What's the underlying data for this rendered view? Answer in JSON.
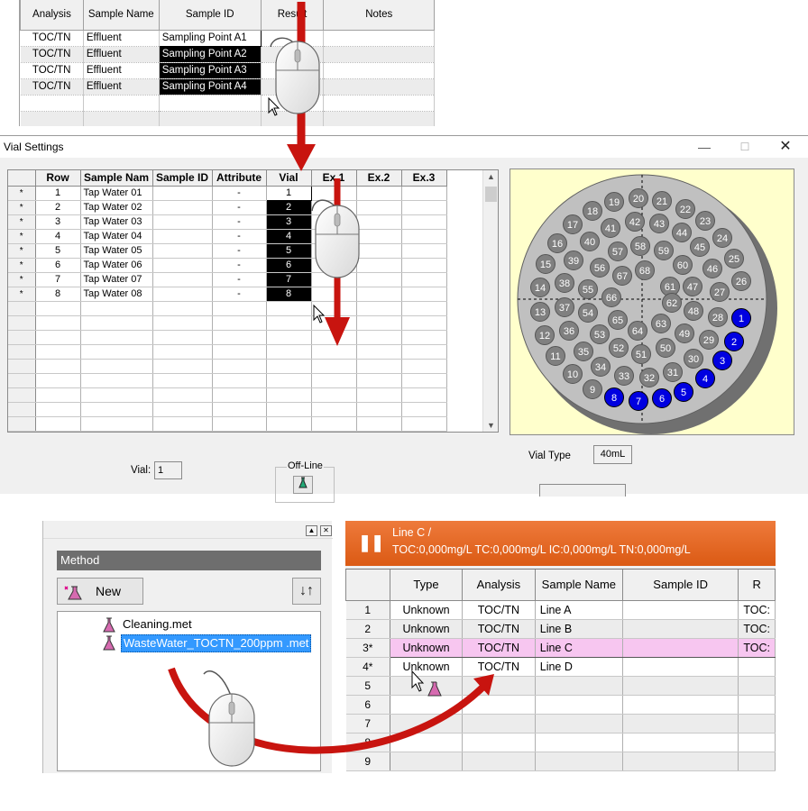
{
  "top_grid": {
    "columns": [
      "Analysis",
      "Sample Name",
      "Sample ID",
      "Result",
      "Notes"
    ],
    "rows": [
      [
        "TOC/TN",
        "Effluent",
        "Sampling Point A1",
        "",
        ""
      ],
      [
        "TOC/TN",
        "Effluent",
        "Sampling Point A2",
        "",
        ""
      ],
      [
        "TOC/TN",
        "Effluent",
        "Sampling Point A3",
        "",
        ""
      ],
      [
        "TOC/TN",
        "Effluent",
        "Sampling Point A4",
        "",
        ""
      ],
      [
        "",
        "",
        "",
        "",
        ""
      ],
      [
        "",
        "",
        "",
        "",
        ""
      ]
    ]
  },
  "vial_settings": {
    "title": "Vial Settings",
    "window_controls": {
      "minimize": "—",
      "maximize": "☐",
      "close": "✕"
    },
    "columns": [
      "Row",
      "Sample Nam",
      "Sample ID",
      "Attribute",
      "Vial",
      "Ex.1",
      "Ex.2",
      "Ex.3"
    ],
    "rows": [
      {
        "marker": "*",
        "row": "1",
        "sample_name": "Tap Water 01",
        "sample_id": "",
        "attribute": "-",
        "vial": "1"
      },
      {
        "marker": "*",
        "row": "2",
        "sample_name": "Tap Water 02",
        "sample_id": "",
        "attribute": "-",
        "vial": "2"
      },
      {
        "marker": "*",
        "row": "3",
        "sample_name": "Tap Water 03",
        "sample_id": "",
        "attribute": "-",
        "vial": "3"
      },
      {
        "marker": "*",
        "row": "4",
        "sample_name": "Tap Water 04",
        "sample_id": "",
        "attribute": "-",
        "vial": "4"
      },
      {
        "marker": "*",
        "row": "5",
        "sample_name": "Tap Water 05",
        "sample_id": "",
        "attribute": "-",
        "vial": "5"
      },
      {
        "marker": "*",
        "row": "6",
        "sample_name": "Tap Water 06",
        "sample_id": "",
        "attribute": "-",
        "vial": "6"
      },
      {
        "marker": "*",
        "row": "7",
        "sample_name": "Tap Water 07",
        "sample_id": "",
        "attribute": "-",
        "vial": "7"
      },
      {
        "marker": "*",
        "row": "8",
        "sample_name": "Tap Water 08",
        "sample_id": "",
        "attribute": "-",
        "vial": "8"
      }
    ],
    "empty_rows": 9,
    "tray": {
      "highlight_color": "#0000e0",
      "normal_color": "#808080",
      "plate_color": "#c0c0c0",
      "highlighted_vials": [
        1,
        2,
        3,
        4,
        5,
        6,
        7,
        8
      ],
      "vial_numbers": [
        1,
        2,
        3,
        4,
        5,
        6,
        7,
        8,
        9,
        10,
        11,
        12,
        13,
        14,
        15,
        16,
        17,
        18,
        19,
        20,
        21,
        22,
        23,
        24,
        25,
        26,
        27,
        28,
        29,
        30,
        31,
        32,
        33,
        34,
        35,
        36,
        37,
        38,
        39,
        40,
        41,
        42,
        43,
        44,
        45,
        46,
        47,
        48,
        49,
        50,
        51,
        52,
        53,
        54,
        55,
        56,
        57,
        58,
        59,
        60,
        61,
        62,
        63,
        64,
        65,
        66,
        67,
        68
      ]
    },
    "vial_type_label": "Vial Type",
    "vial_type_value": "40mL",
    "vial_label": "Vial:",
    "vial_value": "1",
    "offline_label": "Off-Line"
  },
  "method_panel": {
    "topbar_buttons": [
      "▲",
      "✕"
    ],
    "header": "Method",
    "new_button": "New",
    "sort_icon": "↓↑",
    "files": [
      {
        "name": "Cleaning.met",
        "selected": false
      },
      {
        "name": "WasteWater_TOCTN_200ppm .met",
        "selected": true
      }
    ]
  },
  "line_panel": {
    "pause_icon": "❚❚",
    "line_name": "Line C /",
    "values": "TOC:0,000mg/L TC:0,000mg/L IC:0,000mg/L TN:0,000mg/L",
    "columns": [
      "",
      "Type",
      "Analysis",
      "Sample Name",
      "Sample ID",
      "R"
    ],
    "rows": [
      [
        "1",
        "Unknown",
        "TOC/TN",
        "Line A",
        "",
        "TOC:"
      ],
      [
        "2",
        "Unknown",
        "TOC/TN",
        "Line B",
        "",
        "TOC:"
      ],
      [
        "3*",
        "Unknown",
        "TOC/TN",
        "Line C",
        "",
        "TOC:"
      ],
      [
        "4*",
        "Unknown",
        "TOC/TN",
        "Line D",
        "",
        ""
      ],
      [
        "5",
        "",
        "",
        "",
        "",
        ""
      ],
      [
        "6",
        "",
        "",
        "",
        "",
        ""
      ],
      [
        "7",
        "",
        "",
        "",
        "",
        ""
      ],
      [
        "8",
        "",
        "",
        "",
        "",
        ""
      ],
      [
        "9",
        "",
        "",
        "",
        "",
        ""
      ]
    ]
  },
  "colors": {
    "arrow_red": "#c8140f",
    "line_header_orange": "#e56a26",
    "selection_blue": "#3399ff",
    "row_highlight_pink": "#f7c6f0"
  }
}
